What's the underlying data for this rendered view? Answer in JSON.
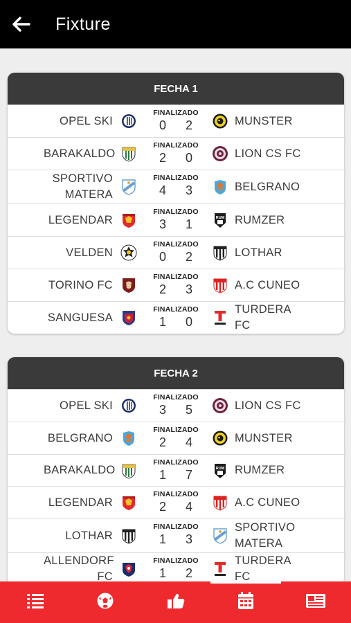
{
  "app_bar": {
    "title": "Fixture"
  },
  "rounds": [
    {
      "title": "FECHA 1",
      "matches": [
        {
          "home": "OPEL SKI",
          "away": "MUNSTER",
          "status": "FINALIZADO",
          "home_score": "0",
          "away_score": "2",
          "home_crest": "opel-ski-crest",
          "away_crest": "munster-crest"
        },
        {
          "home": "BARAKALDO",
          "away": "LION CS FC",
          "status": "FINALIZADO",
          "home_score": "2",
          "away_score": "0",
          "home_crest": "barakaldo-crest",
          "away_crest": "lion-cs-fc-crest"
        },
        {
          "home": "SPORTIVO MATERA",
          "away": "BELGRANO",
          "status": "FINALIZADO",
          "home_score": "4",
          "away_score": "3",
          "home_crest": "sportivo-matera-crest",
          "away_crest": "belgrano-crest"
        },
        {
          "home": "LEGENDAR",
          "away": "RUMZER",
          "status": "FINALIZADO",
          "home_score": "3",
          "away_score": "1",
          "home_crest": "legendar-crest",
          "away_crest": "rumzer-crest"
        },
        {
          "home": "VELDEN",
          "away": "LOTHAR",
          "status": "FINALIZADO",
          "home_score": "0",
          "away_score": "2",
          "home_crest": "velden-crest",
          "away_crest": "lothar-crest"
        },
        {
          "home": "TORINO FC",
          "away": "A.C CUNEO",
          "status": "FINALIZADO",
          "home_score": "2",
          "away_score": "3",
          "home_crest": "torino-fc-crest",
          "away_crest": "ac-cuneo-crest"
        },
        {
          "home": "SANGUESA",
          "away": "TURDERA FC",
          "status": "FINALIZADO",
          "home_score": "1",
          "away_score": "0",
          "home_crest": "sanguesa-crest",
          "away_crest": "turdera-fc-crest"
        }
      ]
    },
    {
      "title": "FECHA 2",
      "matches": [
        {
          "home": "OPEL SKI",
          "away": "LION CS FC",
          "status": "FINALIZADO",
          "home_score": "3",
          "away_score": "5",
          "home_crest": "opel-ski-crest",
          "away_crest": "lion-cs-fc-crest"
        },
        {
          "home": "BELGRANO",
          "away": "MUNSTER",
          "status": "FINALIZADO",
          "home_score": "2",
          "away_score": "4",
          "home_crest": "belgrano-crest",
          "away_crest": "munster-crest"
        },
        {
          "home": "BARAKALDO",
          "away": "RUMZER",
          "status": "FINALIZADO",
          "home_score": "1",
          "away_score": "7",
          "home_crest": "barakaldo-crest",
          "away_crest": "rumzer-crest"
        },
        {
          "home": "LEGENDAR",
          "away": "A.C CUNEO",
          "status": "FINALIZADO",
          "home_score": "2",
          "away_score": "4",
          "home_crest": "legendar-crest",
          "away_crest": "ac-cuneo-crest"
        },
        {
          "home": "LOTHAR",
          "away": "SPORTIVO MATERA",
          "status": "FINALIZADO",
          "home_score": "1",
          "away_score": "3",
          "home_crest": "lothar-crest",
          "away_crest": "sportivo-matera-crest"
        },
        {
          "home": "ALLENDORF FC",
          "away": "TURDERA FC",
          "status": "FINALIZADO",
          "home_score": "1",
          "away_score": "2",
          "home_crest": "allendorf-fc-crest",
          "away_crest": "turdera-fc-crest"
        }
      ]
    }
  ],
  "bottom_nav": {
    "items": [
      {
        "icon": "list-icon",
        "active": false
      },
      {
        "icon": "soccer-ball-icon",
        "active": false
      },
      {
        "icon": "thumbs-up-icon",
        "active": false
      },
      {
        "icon": "calendar-icon",
        "active": true
      },
      {
        "icon": "newspaper-icon",
        "active": false
      }
    ]
  },
  "colors": {
    "app_bar": "#000000",
    "round_header": "#3a3a3a",
    "bottom_nav": "#ef2a2f"
  }
}
